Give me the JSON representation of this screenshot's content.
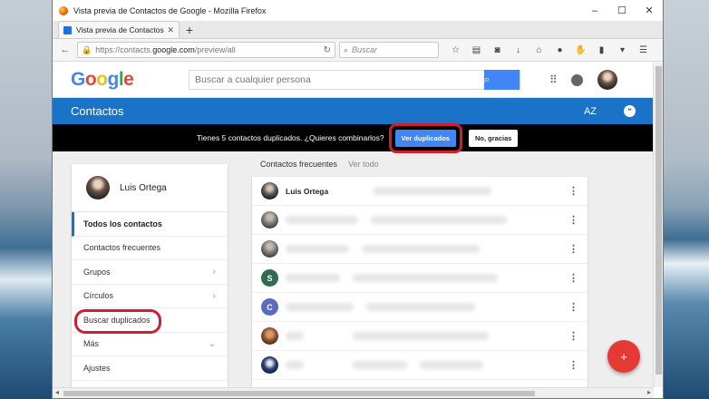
{
  "window": {
    "title": "Vista previa de Contactos de Google - Mozilla Firefox",
    "controls": [
      "–",
      "☐",
      "✕"
    ]
  },
  "tab": {
    "title": "Vista previa de Contactos ...",
    "close": "✕",
    "new": "+"
  },
  "nav": {
    "url_prefix": "https://contacts.",
    "url_domain": "google.com",
    "url_path": "/preview/all",
    "search_placeholder": "Buscar"
  },
  "google": {
    "logo": [
      "G",
      "o",
      "o",
      "g",
      "l",
      "e"
    ],
    "search_placeholder": "Buscar a cualquier persona"
  },
  "contacts_bar": {
    "title": "Contactos",
    "sort_label": "AZ"
  },
  "dup_banner": {
    "message": "Tienes 5 contactos duplicados. ¿Quieres combinarlos?",
    "view_button": "Ver duplicados",
    "dismiss_button": "No, gracias"
  },
  "sidebar": {
    "user_name": "Luis Ortega",
    "items": [
      {
        "label": "Todos los contactos",
        "chevron": ""
      },
      {
        "label": "Contactos frecuentes",
        "chevron": ""
      },
      {
        "label": "Grupos",
        "chevron": "›"
      },
      {
        "label": "Círculos",
        "chevron": "›"
      },
      {
        "label": "Buscar duplicados",
        "chevron": ""
      },
      {
        "label": "Más",
        "chevron": "⌄"
      },
      {
        "label": "Ajustes",
        "chevron": ""
      }
    ]
  },
  "list_tabs": {
    "frequent": "Contactos frecuentes",
    "all": "Ver todo"
  },
  "contacts": [
    {
      "name": "Luis Ortega",
      "initial": ""
    },
    {
      "name": "",
      "initial": ""
    },
    {
      "name": "",
      "initial": ""
    },
    {
      "name": "",
      "initial": "S"
    },
    {
      "name": "",
      "initial": "C"
    },
    {
      "name": "",
      "initial": ""
    },
    {
      "name": "",
      "initial": ""
    }
  ],
  "colors": {
    "accent": "#1a73c6",
    "highlight_ring": "#d01e2c",
    "fab": "#e53935",
    "avatar_s": "#2e6b4f",
    "avatar_c": "#5c6bc0"
  },
  "icons": {
    "back": "←",
    "lock": "🔒",
    "reload": "↻",
    "search": "⌕",
    "more_vert": "⋮",
    "fab": "+"
  }
}
